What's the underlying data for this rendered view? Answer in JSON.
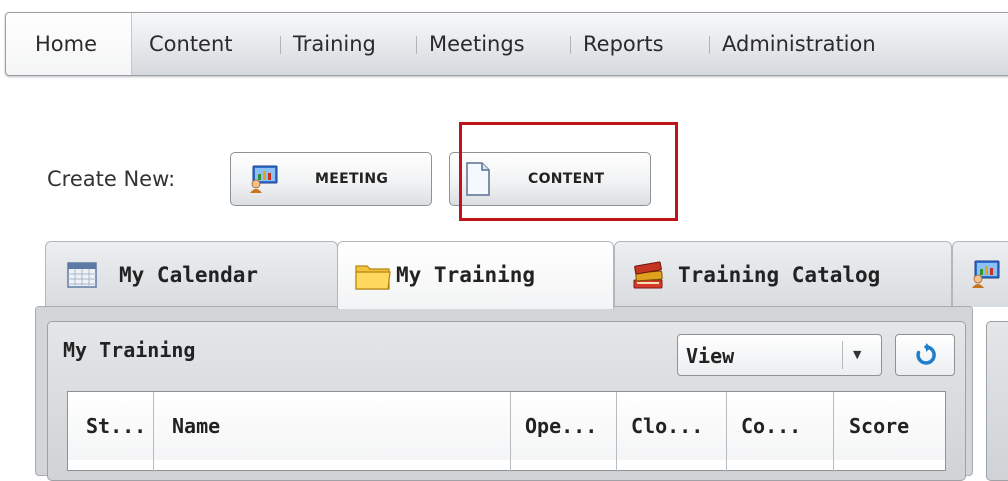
{
  "nav": {
    "items": [
      {
        "label": "Home",
        "active": true
      },
      {
        "label": "Content"
      },
      {
        "label": "Training"
      },
      {
        "label": "Meetings"
      },
      {
        "label": "Reports"
      },
      {
        "label": "Administration"
      }
    ]
  },
  "create": {
    "label": "Create New:",
    "meeting_label": "MEETING",
    "content_label": "CONTENT",
    "meeting_icon": "meeting-presentation-icon",
    "content_icon": "document-icon"
  },
  "tabs": [
    {
      "label": "My Calendar",
      "icon": "calendar-icon"
    },
    {
      "label": "My Training",
      "icon": "folder-icon",
      "active": true
    },
    {
      "label": "Training Catalog",
      "icon": "books-icon"
    },
    {
      "label": "",
      "icon": "meeting-presentation-icon"
    }
  ],
  "panel": {
    "title": "My Training",
    "view_label": "View",
    "refresh_icon": "refresh-icon"
  },
  "table": {
    "columns": [
      "St...",
      "Name",
      "Ope...",
      "Clo...",
      "Co...",
      "Score"
    ]
  },
  "colors": {
    "highlight": "#c0141a",
    "nav_bg": "#e9ebee",
    "panel_bg": "#d3d6d9"
  }
}
